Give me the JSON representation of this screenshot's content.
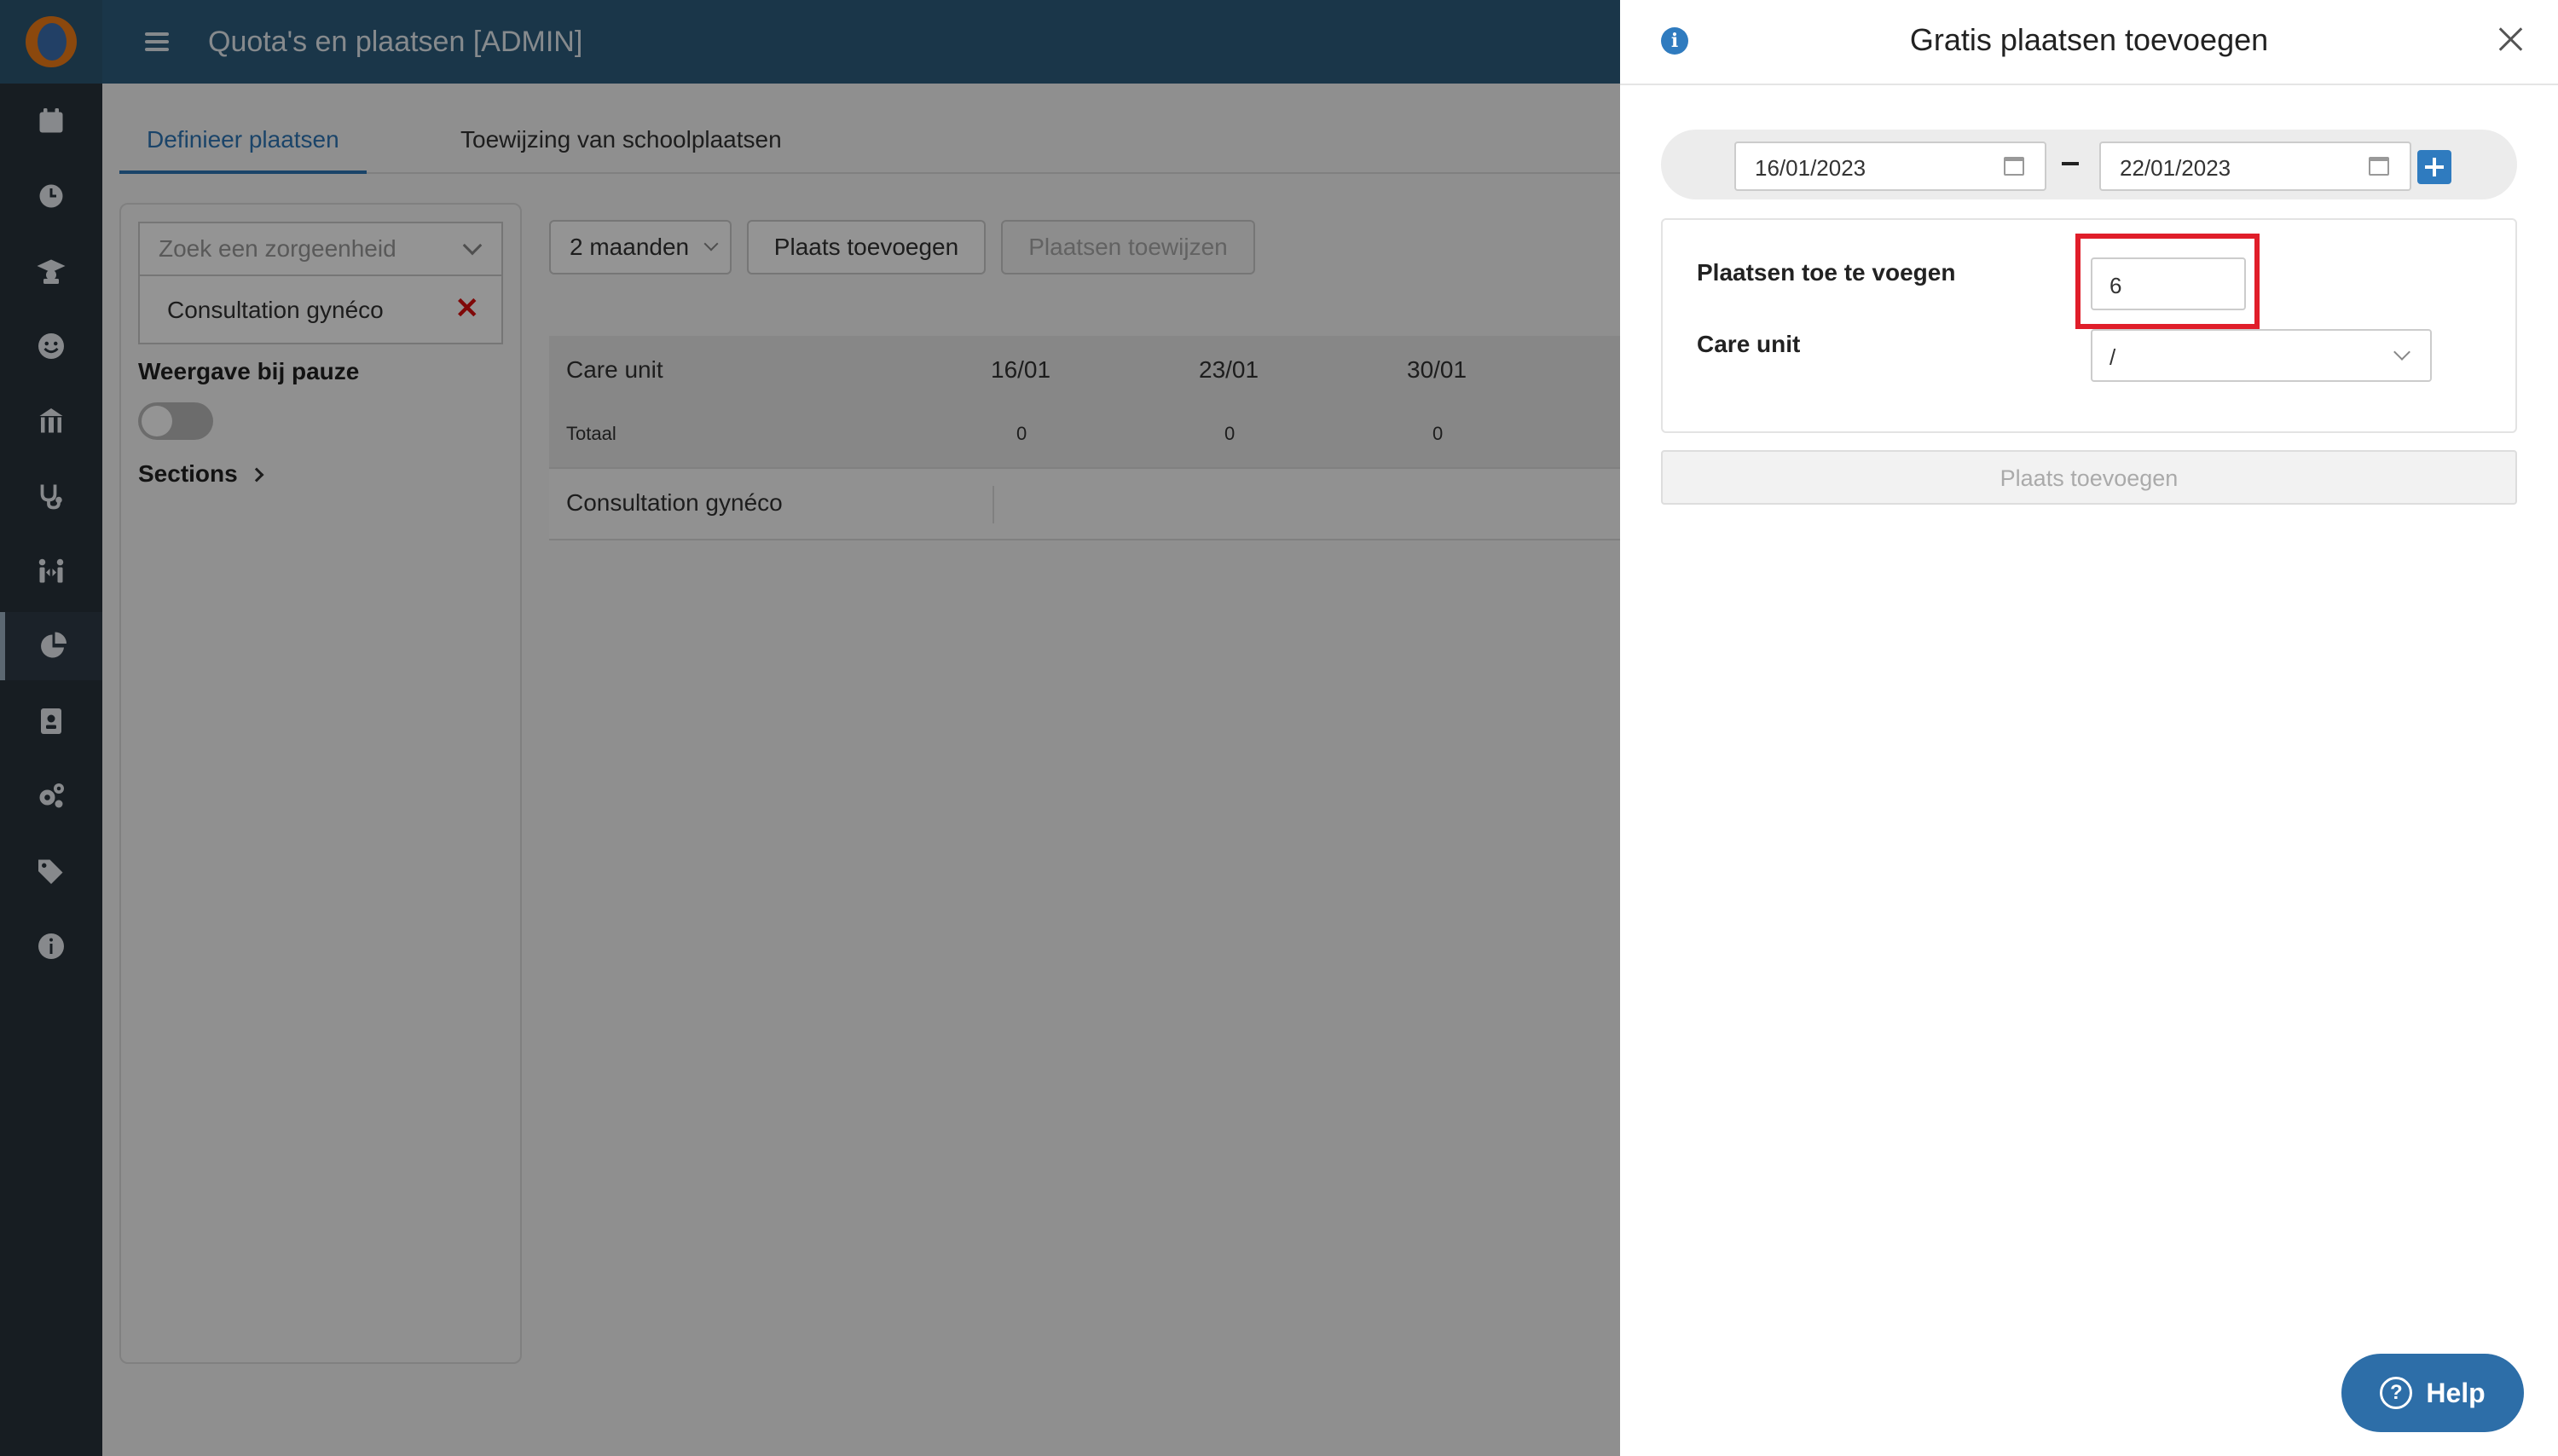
{
  "app": {
    "title": "Quota's en plaatsen [ADMIN]"
  },
  "sidebar": {
    "items": [
      {
        "icon": "calendar-icon"
      },
      {
        "icon": "clock-icon"
      },
      {
        "icon": "graduation-cap-icon"
      },
      {
        "icon": "smiley-icon"
      },
      {
        "icon": "school-icon"
      },
      {
        "icon": "stethoscope-icon"
      },
      {
        "icon": "people-arrows-icon"
      },
      {
        "icon": "pie-chart-icon",
        "active": true
      },
      {
        "icon": "id-badge-icon"
      },
      {
        "icon": "gears-icon"
      },
      {
        "icon": "tags-icon"
      },
      {
        "icon": "info-icon"
      }
    ]
  },
  "tabs": [
    "Definieer plaatsen",
    "Toewijzing van schoolplaatsen"
  ],
  "filter": {
    "search_placeholder": "Zoek een zorgeenheid",
    "chip": "Consultation gynéco",
    "pause_label": "Weergave bij pauze",
    "sections_label": "Sections"
  },
  "toolbar": {
    "period": "2 maanden",
    "add_place": "Plaats toevoegen",
    "assign_places": "Plaatsen toewijzen"
  },
  "table": {
    "col_care_unit": "Care unit",
    "weeks": [
      "16/01",
      "23/01",
      "30/01"
    ],
    "total_label": "Totaal",
    "totals": [
      "0",
      "0",
      "0"
    ],
    "rows": [
      "Consultation gynéco"
    ]
  },
  "drawer": {
    "title": "Gratis plaatsen toevoegen",
    "date_from": "16/01/2023",
    "date_to": "22/01/2023",
    "places_label": "Plaatsen toe te voegen",
    "places_value": "6",
    "care_unit_label": "Care unit",
    "care_unit_value": "/",
    "submit": "Plaats toevoegen"
  },
  "help": {
    "label": "Help"
  },
  "colors": {
    "accent": "#2f7bbf",
    "highlight": "#e01e2a",
    "sidebar": "#28323b",
    "topbar": "#2e5d7f"
  }
}
